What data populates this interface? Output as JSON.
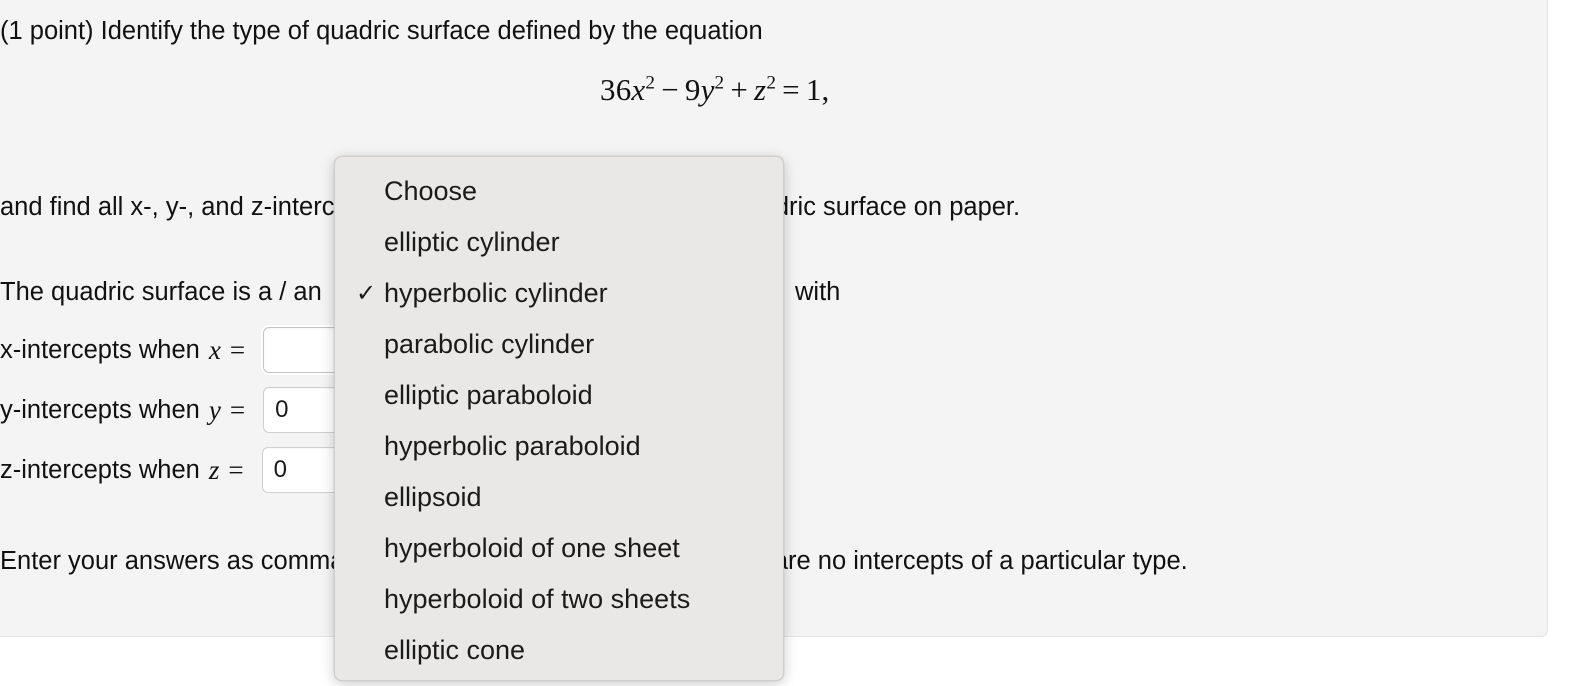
{
  "problem": {
    "heading": "(1 point) Identify the type of quadric surface defined by the equation",
    "equation": {
      "coef1": "36",
      "var1": "x",
      "pow1": "2",
      "op1": "−",
      "coef2": "9",
      "var2": "y",
      "pow2": "2",
      "op2": "+",
      "var3": "z",
      "pow3": "2",
      "op3": "=",
      "rhs": "1,"
    },
    "instruction_line": "and find all x-, y-, and z-intercepts. Then sketch the graph of this quadric surface on paper.",
    "classify_prefix": "The quadric surface is a / an",
    "classify_suffix": "with",
    "footer_note": "Enter your answers as comma separated lists, or enter none if there are no intercepts of a particular type."
  },
  "answers": [
    {
      "label": "-intercepts when",
      "variable": "x",
      "equals": "=",
      "value": "",
      "placeholder": ""
    },
    {
      "label": "-intercepts when",
      "variable": "y",
      "equals": "=",
      "value": "0",
      "placeholder": ""
    },
    {
      "label": "-intercepts when",
      "variable": "z",
      "equals": "=",
      "value": "0",
      "placeholder": ""
    }
  ],
  "answer_prefixes": [
    "x",
    "y",
    "z"
  ],
  "dropdown": {
    "selected": "hyperbolic cylinder",
    "check_glyph": "✓",
    "options": [
      {
        "label": "Choose",
        "selected": false
      },
      {
        "label": "elliptic cylinder",
        "selected": false
      },
      {
        "label": "hyperbolic cylinder",
        "selected": true
      },
      {
        "label": "parabolic cylinder",
        "selected": false
      },
      {
        "label": "elliptic paraboloid",
        "selected": false
      },
      {
        "label": "hyperbolic paraboloid",
        "selected": false
      },
      {
        "label": "ellipsoid",
        "selected": false
      },
      {
        "label": "hyperboloid of one sheet",
        "selected": false
      },
      {
        "label": "hyperboloid of two sheets",
        "selected": false
      },
      {
        "label": "elliptic cone",
        "selected": false
      }
    ]
  },
  "colors": {
    "panel_background": "#f4f4f4",
    "page_background": "#ffffff",
    "popup_background": "#e9e8e7",
    "text": "#111111",
    "field_background": "#ffffff",
    "field_border": "#cfcfcf"
  }
}
